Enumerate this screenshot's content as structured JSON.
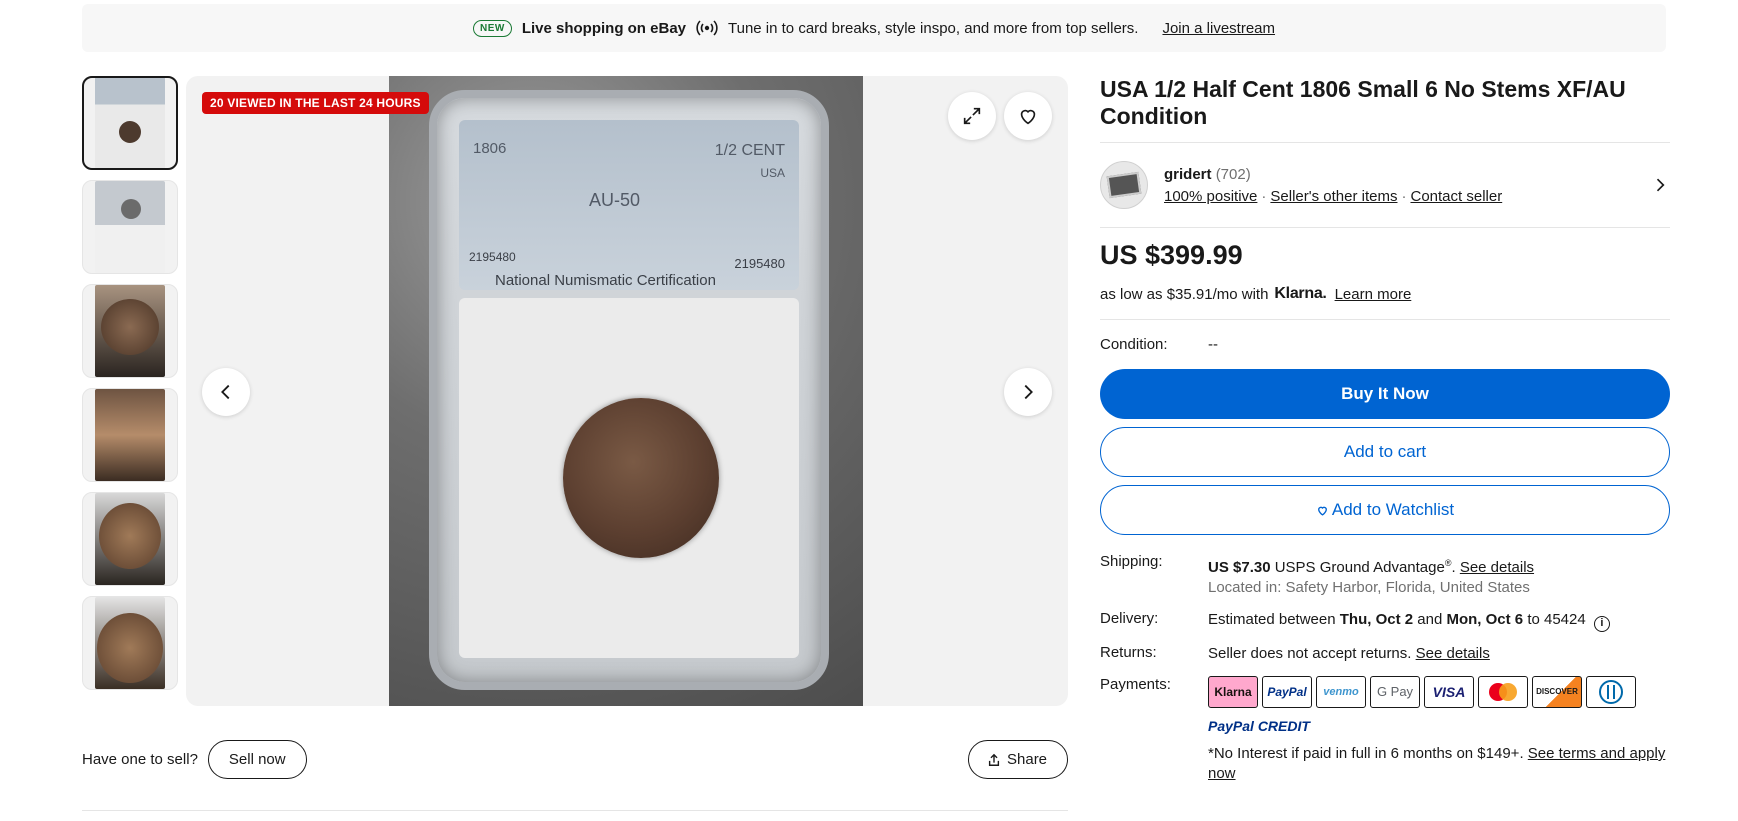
{
  "banner": {
    "badge": "NEW",
    "title": "Live shopping on eBay",
    "text": "Tune in to card breaks, style inspo, and more from top sellers.",
    "link": "Join a livestream"
  },
  "gallery": {
    "viewed_badge": "20 VIEWED IN THE LAST 24 HOURS",
    "slab_label": {
      "year": "1806",
      "denomination": "1/2 CENT",
      "country": "USA",
      "grade": "AU-50",
      "cert_left": "2195480",
      "cert_right": "2195480",
      "org": "National Numismatic Certification"
    },
    "thumbnail_count": 6
  },
  "sell_row": {
    "question": "Have one to sell?",
    "sell_button": "Sell now",
    "share_button": "Share"
  },
  "listing": {
    "title": "USA 1/2 Half Cent 1806 Small 6 No Stems XF/AU Condition",
    "seller": {
      "name": "gridert",
      "feedback_count": "(702)",
      "positive": "100% positive",
      "other_items": "Seller's other items",
      "contact": "Contact seller"
    },
    "price": "US $399.99",
    "klarna": {
      "prefix": "as low as $35.91/mo with",
      "brand": "Klarna.",
      "link": "Learn more"
    },
    "condition_label": "Condition:",
    "condition_value": "--",
    "buttons": {
      "buy": "Buy It Now",
      "cart": "Add to cart",
      "watch": "Add to Watchlist"
    },
    "shipping": {
      "label": "Shipping:",
      "cost": "US $7.30",
      "service": "USPS Ground Advantage",
      "reg": "®",
      "link": "See details",
      "location": "Located in: Safety Harbor, Florida, United States"
    },
    "delivery": {
      "label": "Delivery:",
      "prefix": "Estimated between",
      "start": "Thu, Oct 2",
      "and": "and",
      "end": "Mon, Oct 6",
      "to": "to 45424"
    },
    "returns": {
      "label": "Returns:",
      "text": "Seller does not accept returns.",
      "link": "See details"
    },
    "payments": {
      "label": "Payments:",
      "logos": [
        "Klarna",
        "PayPal",
        "venmo",
        "G Pay",
        "VISA",
        "Mastercard",
        "DISCOVER",
        "Diners"
      ],
      "credit": "PayPal CREDIT",
      "terms": "*No Interest if paid in full in 6 months on $149+.",
      "terms_link": "See terms and apply now"
    }
  },
  "colors": {
    "primary_blue": "#0064d2",
    "badge_red": "#d50b0b",
    "banner_bg": "#f7f7f7"
  }
}
